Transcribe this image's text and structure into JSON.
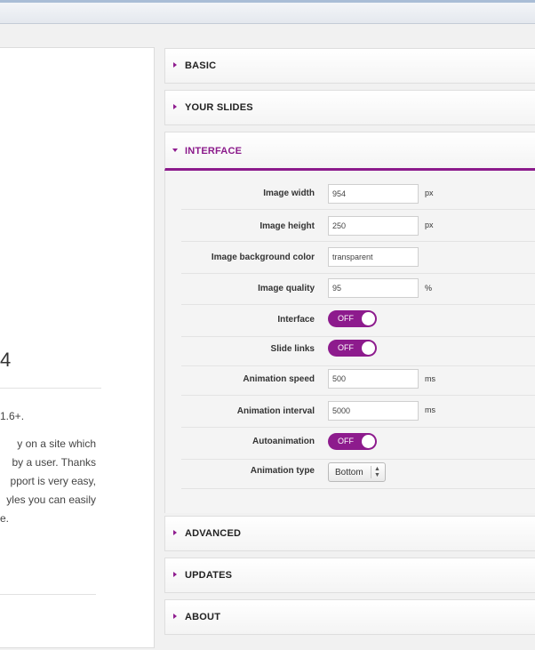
{
  "left": {
    "heading": "4",
    "lines": [
      "1.6+.",
      "y on a site which",
      "by a user. Thanks",
      "pport is very easy,",
      "yles you can easily",
      "e."
    ]
  },
  "accordion": {
    "basic": "BASIC",
    "your_slides": "YOUR SLIDES",
    "interface": "INTERFACE",
    "advanced": "ADVANCED",
    "updates": "UPDATES",
    "about": "ABOUT"
  },
  "interface": {
    "image_width": {
      "label": "Image width",
      "value": "954",
      "unit": "px"
    },
    "image_height": {
      "label": "Image height",
      "value": "250",
      "unit": "px"
    },
    "bg_color": {
      "label": "Image background color",
      "value": "transparent"
    },
    "quality": {
      "label": "Image quality",
      "value": "95",
      "unit": "%"
    },
    "interface_toggle": {
      "label": "Interface",
      "state": "OFF"
    },
    "slide_links": {
      "label": "Slide links",
      "state": "OFF"
    },
    "anim_speed": {
      "label": "Animation speed",
      "value": "500",
      "unit": "ms"
    },
    "anim_interval": {
      "label": "Animation interval",
      "value": "5000",
      "unit": "ms"
    },
    "autoanimation": {
      "label": "Autoanimation",
      "state": "OFF"
    },
    "anim_type": {
      "label": "Animation type",
      "value": "Bottom",
      "options_icon": "up-down-arrows-icon"
    }
  },
  "colors": {
    "accent": "#8b1a8b"
  }
}
